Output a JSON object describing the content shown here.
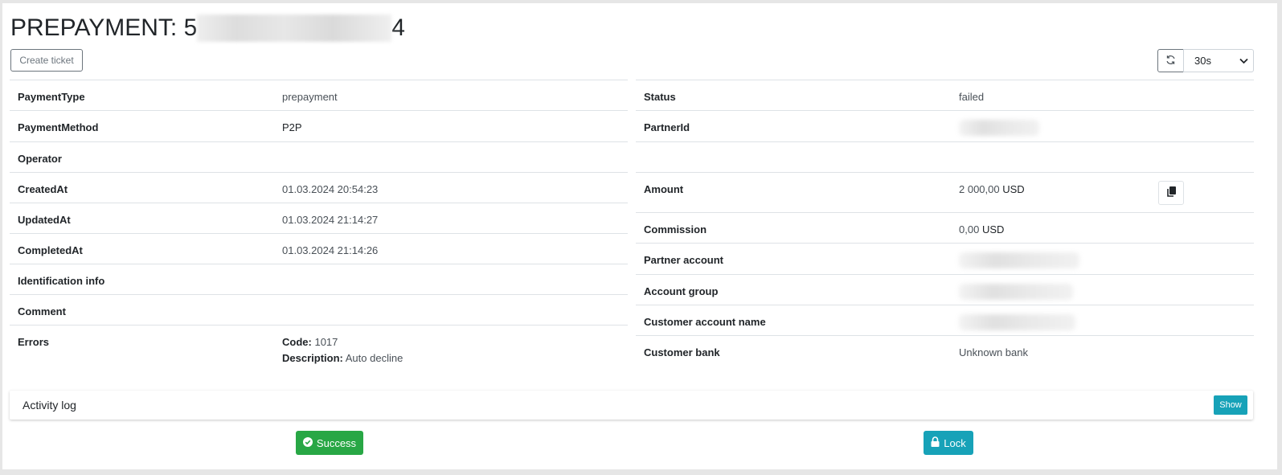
{
  "title": {
    "prefix": "PREPAYMENT: 5",
    "suffix": "4"
  },
  "toolbar": {
    "create_ticket_label": "Create ticket",
    "refresh_interval": "30s"
  },
  "left": {
    "payment_type": {
      "label": "PaymentType",
      "value": "prepayment"
    },
    "payment_method": {
      "label": "PaymentMethod",
      "value": "P2P"
    },
    "operator": {
      "label": "Operator",
      "value": ""
    },
    "created_at": {
      "label": "CreatedAt",
      "value": "01.03.2024 20:54:23"
    },
    "updated_at": {
      "label": "UpdatedAt",
      "value": "01.03.2024 21:14:27"
    },
    "completed_at": {
      "label": "CompletedAt",
      "value": "01.03.2024 21:14:26"
    },
    "identification_info": {
      "label": "Identification info",
      "value": ""
    },
    "comment": {
      "label": "Comment",
      "value": ""
    },
    "errors": {
      "label": "Errors",
      "code_label": "Code:",
      "code": "1017",
      "description_label": "Description:",
      "description": "Auto decline"
    }
  },
  "right": {
    "status": {
      "label": "Status",
      "value": "failed"
    },
    "partner_id": {
      "label": "PartnerId"
    },
    "amount": {
      "label": "Amount",
      "value": "2 000,00",
      "currency": "USD"
    },
    "commission": {
      "label": "Commission",
      "value": "0,00",
      "currency": "USD"
    },
    "partner_account": {
      "label": "Partner account"
    },
    "account_group": {
      "label": "Account group"
    },
    "customer_account_name": {
      "label": "Customer account name"
    },
    "customer_bank": {
      "label": "Customer bank",
      "value": "Unknown bank"
    }
  },
  "activity_log": {
    "label": "Activity log",
    "show_label": "Show"
  },
  "actions": {
    "success_label": "Success",
    "lock_label": "Lock"
  },
  "colors": {
    "success": "#28a745",
    "info": "#17a2b8",
    "border": "#dee2e6"
  },
  "icons": {
    "refresh": "refresh-icon",
    "copy": "copy-icon",
    "check": "check-circle-icon",
    "lock": "lock-icon",
    "chevron": "chevron-down-icon"
  }
}
